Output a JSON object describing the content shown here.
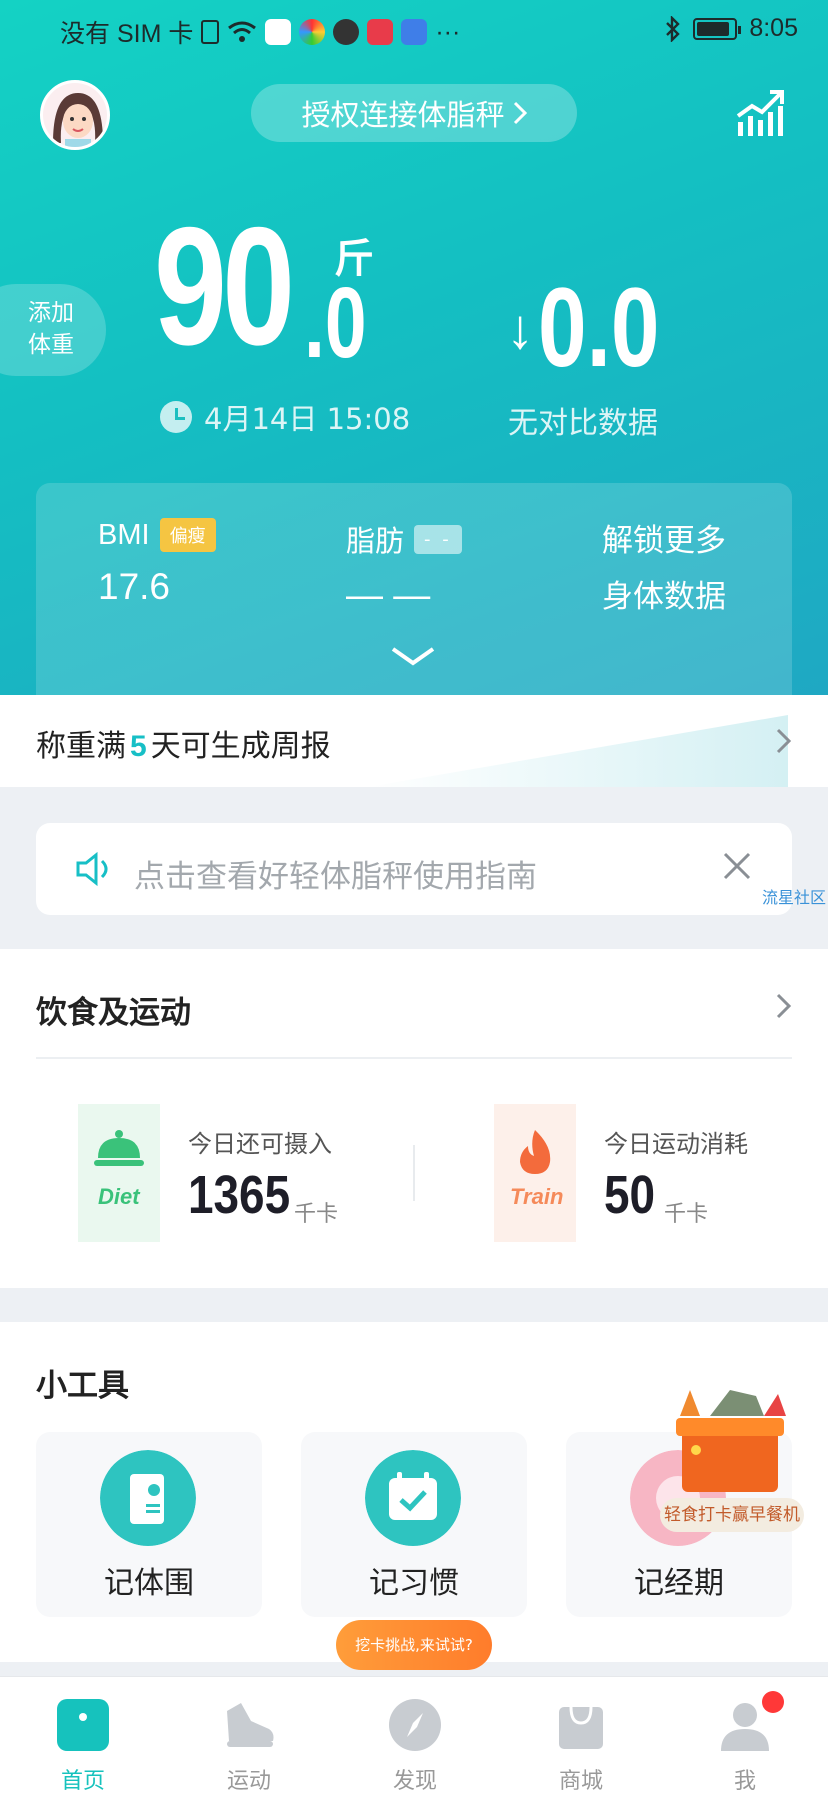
{
  "status_bar": {
    "carrier": "没有 SIM 卡",
    "more": "···",
    "time": "8:05"
  },
  "header": {
    "connect_label": "授权连接体脂秤"
  },
  "weight": {
    "add_weight_label": "添加\n体重",
    "integer_part": "90",
    "decimal_part": ".0",
    "unit": "斤",
    "timestamp": "4月14日 15:08"
  },
  "diff": {
    "arrow": "↓",
    "value": "0.0",
    "label": "无对比数据"
  },
  "metrics": {
    "bmi_label": "BMI",
    "bmi_badge": "偏瘦",
    "bmi_value": "17.6",
    "fat_label": "脂肪",
    "fat_badge": "- -",
    "fat_value": "— —",
    "unlock_line1": "解锁更多",
    "unlock_line2": "身体数据"
  },
  "report": {
    "prefix": "称重满",
    "days": "5",
    "suffix": "天可生成周报"
  },
  "guide": {
    "text": "点击查看好轻体脂秤使用指南",
    "side_link": "流星社区"
  },
  "diet_exercise": {
    "title": "饮食及运动",
    "diet_tag": "Diet",
    "diet_label": "今日还可摄入",
    "diet_value": "1365",
    "diet_unit": "千卡",
    "train_tag": "Train",
    "train_label": "今日运动消耗",
    "train_value": "50",
    "train_unit": "千卡"
  },
  "tools": {
    "title": "小工具",
    "items": [
      {
        "label": "记体围"
      },
      {
        "label": "记习惯"
      },
      {
        "label": "记经期"
      }
    ],
    "promo_badge": "轻食打卡赢早餐机"
  },
  "challenge": {
    "label": "挖卡挑战,来试试?"
  },
  "tabbar": {
    "items": [
      {
        "label": "首页"
      },
      {
        "label": "运动"
      },
      {
        "label": "发现"
      },
      {
        "label": "商城"
      },
      {
        "label": "我"
      }
    ]
  },
  "colors": {
    "brand": "#16c2bd",
    "badge_yellow": "#f5c542",
    "orange": "#ff7c2b"
  }
}
